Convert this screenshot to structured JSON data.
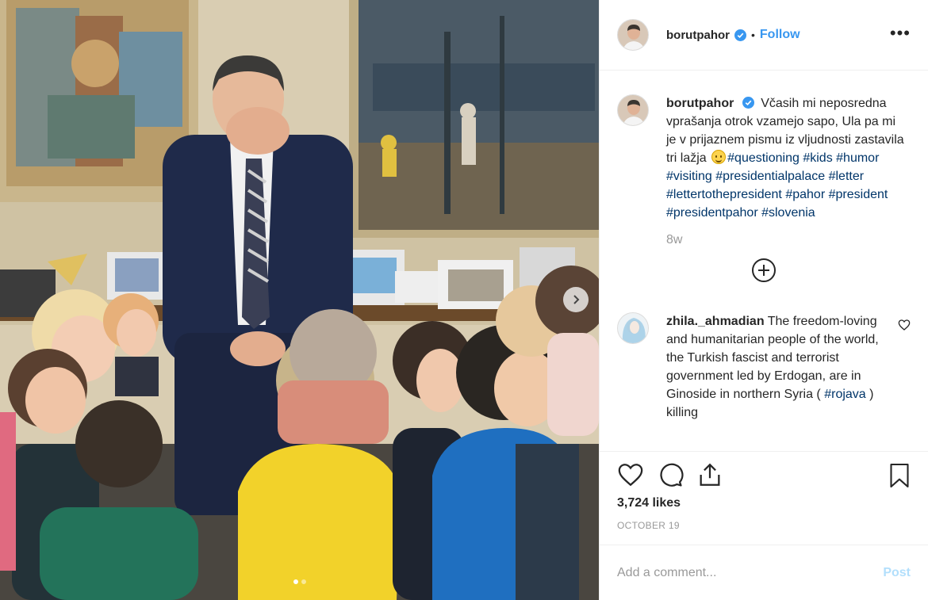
{
  "header": {
    "username": "borutpahor",
    "separator": "•",
    "follow_label": "Follow",
    "more_label": "•••"
  },
  "caption": {
    "username": "borutpahor",
    "text": "Včasih mi neposredna vprašanja otrok vzamejo sapo, Ula pa mi je v prijaznem pismu iz vljudnosti zastavila tri lažja",
    "emoji": "smiling-face-emoji",
    "hashtags": [
      "#questioning",
      "#kids",
      "#humor",
      "#visiting",
      "#presidentialpalace",
      "#letter",
      "#lettertothepresident",
      "#pahor",
      "#president",
      "#presidentpahor",
      "#slovenia"
    ],
    "time_ago": "8w"
  },
  "comment": {
    "username": "zhila._ahmadian",
    "text_before": "The freedom-loving and humanitarian people of the world, the Turkish fascist and terrorist government led by Erdogan, are in Ginoside in northern Syria (",
    "hashtag": "#rojava",
    "text_after": ") killing"
  },
  "actions": {
    "likes": "3,724 likes",
    "date": "OCTOBER 19"
  },
  "composer": {
    "placeholder": "Add a comment...",
    "post_label": "Post"
  },
  "carousel": {
    "slide_count": 2,
    "active_slide": 1
  },
  "colors": {
    "link_blue": "#3897f0",
    "hashtag": "#003569",
    "verified": "#3897f0",
    "muted": "#999999",
    "post_disabled": "#b2dffc"
  }
}
